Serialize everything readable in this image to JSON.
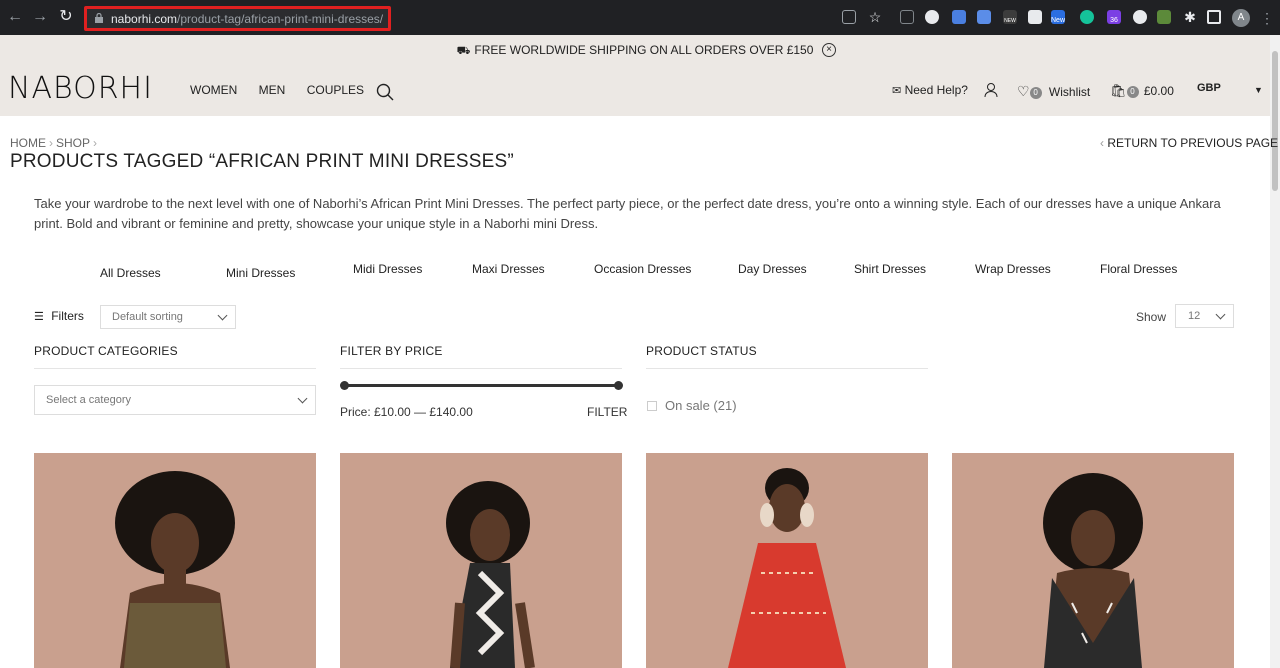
{
  "browser": {
    "url_domain": "naborhi.com",
    "url_path": "/product-tag/african-print-mini-dresses/",
    "profile_initial": "A",
    "ext_badges": [
      "NEW",
      "New",
      "36"
    ]
  },
  "topbar": {
    "shipping_text": "FREE WORLDWIDE SHIPPING ON ALL ORDERS OVER £150",
    "close_glyph": "×"
  },
  "header": {
    "logo": "NABORHI",
    "nav": [
      "WOMEN",
      "MEN",
      "COUPLES"
    ],
    "need_help": "Need Help?",
    "wishlist_count": "0",
    "wishlist_label": "Wishlist",
    "cart_count": "0",
    "cart_total": "£0.00",
    "currency": "GBP"
  },
  "breadcrumb": {
    "home": "HOME",
    "shop": "SHOP"
  },
  "return_link": "RETURN TO PREVIOUS PAGE",
  "page_title": "PRODUCTS TAGGED “AFRICAN PRINT MINI DRESSES”",
  "intro": "Take your wardrobe to the next level with one of Naborhi’s African Print Mini Dresses. The perfect party piece, or the perfect date dress, you’re onto a winning style. Each of our dresses have a unique Ankara print. Bold and vibrant or feminine and pretty, showcase your unique style in a Naborhi mini Dress.",
  "categories": [
    "All Dresses",
    "Mini Dresses",
    "Midi Dresses",
    "Maxi Dresses",
    "Occasion Dresses",
    "Day Dresses",
    "Shirt Dresses",
    "Wrap Dresses",
    "Floral Dresses"
  ],
  "toolbar": {
    "filters_label": "Filters",
    "sort_value": "Default sorting",
    "show_label": "Show",
    "show_value": "12"
  },
  "widgets": {
    "categories_title": "PRODUCT CATEGORIES",
    "category_placeholder": "Select a category",
    "price_title": "FILTER BY PRICE",
    "price_label": "Price: £10.00 — £140.00",
    "filter_button": "FILTER",
    "status_title": "PRODUCT STATUS",
    "on_sale": "On sale (21)"
  },
  "products": [
    {
      "dress_color": "#6b5a3a"
    },
    {
      "dress_color": "#2a2a2a"
    },
    {
      "dress_color": "#d83a2e"
    },
    {
      "dress_color": "#2b2b2b"
    }
  ]
}
